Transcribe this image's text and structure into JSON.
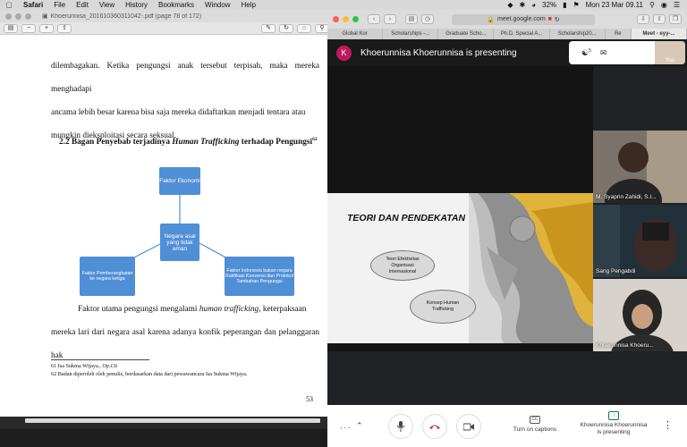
{
  "menubar": {
    "apple": "",
    "items": [
      "Safari",
      "File",
      "Edit",
      "View",
      "History",
      "Bookmarks",
      "Window",
      "Help"
    ],
    "battery": "32%",
    "datetime": "Mon 23 Mar  09.11"
  },
  "pdf": {
    "window_title": "Khoerunnisa_201610360311042-.pdf (page 78 of 172)",
    "para_top": [
      "dilembagakan. Ketika pengungsi anak tersebut terpisah, maka mereka menghadapi",
      "ancama lebih besar karena bisa saja mereka didaftarkan menjadi tentara atau",
      "mungkin dieksploitasi secara seksual."
    ],
    "heading_prefix": "2.2 Bagan Penyebab terjadinya ",
    "heading_italic": "Human Trafficking",
    "heading_suffix": " terhadap Pengungsi",
    "heading_sup": "62",
    "diagram": {
      "top": "Faktor Ekonomi",
      "center": "Negara asal yang tidak aman",
      "left": "Faktor Pemberangkatan ke negara ketiga",
      "right": "Faktor Indonesia bukan negara Ratifikasi Konvensi dan Protokol Tambahan Pengungsi"
    },
    "para_bottom_1_start": "Faktor utama pengungsi mengalami ",
    "para_bottom_1_italic": "human trafficking",
    "para_bottom_1_end": ", keterpaksaan",
    "para_bottom_2": "mereka lari dari negara asal karena adanya konfik peperangan dan pelanggaran hak",
    "footnote_61_start": "61 Isa Sukma Wijaya., ",
    "footnote_61_italic": "Op.Cit",
    "footnote_62": "62 Badan diperoleh oleh penulis, berdasarkan data dari pewawancara Isa Sukma Wijaya.",
    "page_number": "53"
  },
  "browser": {
    "url": "meet.google.com",
    "tabs": [
      "Global Kor",
      "Scholarships -...",
      "Graduate Scho...",
      "Ph.D. Special A...",
      "Scholarship20...",
      "Re",
      "Meet - eyy-..."
    ]
  },
  "meet": {
    "presenter_initial": "K",
    "presenting_banner": "Khoerunnisa Khoerunnisa is presenting",
    "participant_count": "5",
    "self_label": "You",
    "slide": {
      "title": "TEORI DAN PENDEKATAN",
      "cloud1": "Teori Efektivitas Organisasi Internasional",
      "cloud2": "Konsep Human Trafficking"
    },
    "participants": [
      {
        "name": "M. Syaprin Zahidi, S.I..."
      },
      {
        "name": "Sang Pengabdi"
      },
      {
        "name": "Khoerunnisa Khoeru..."
      }
    ],
    "controls": {
      "more_left": "...",
      "captions": "Turn on captions",
      "presenting_line1": "Khoerunnisa Khoerunnisa",
      "presenting_line2": "is presenting"
    }
  }
}
